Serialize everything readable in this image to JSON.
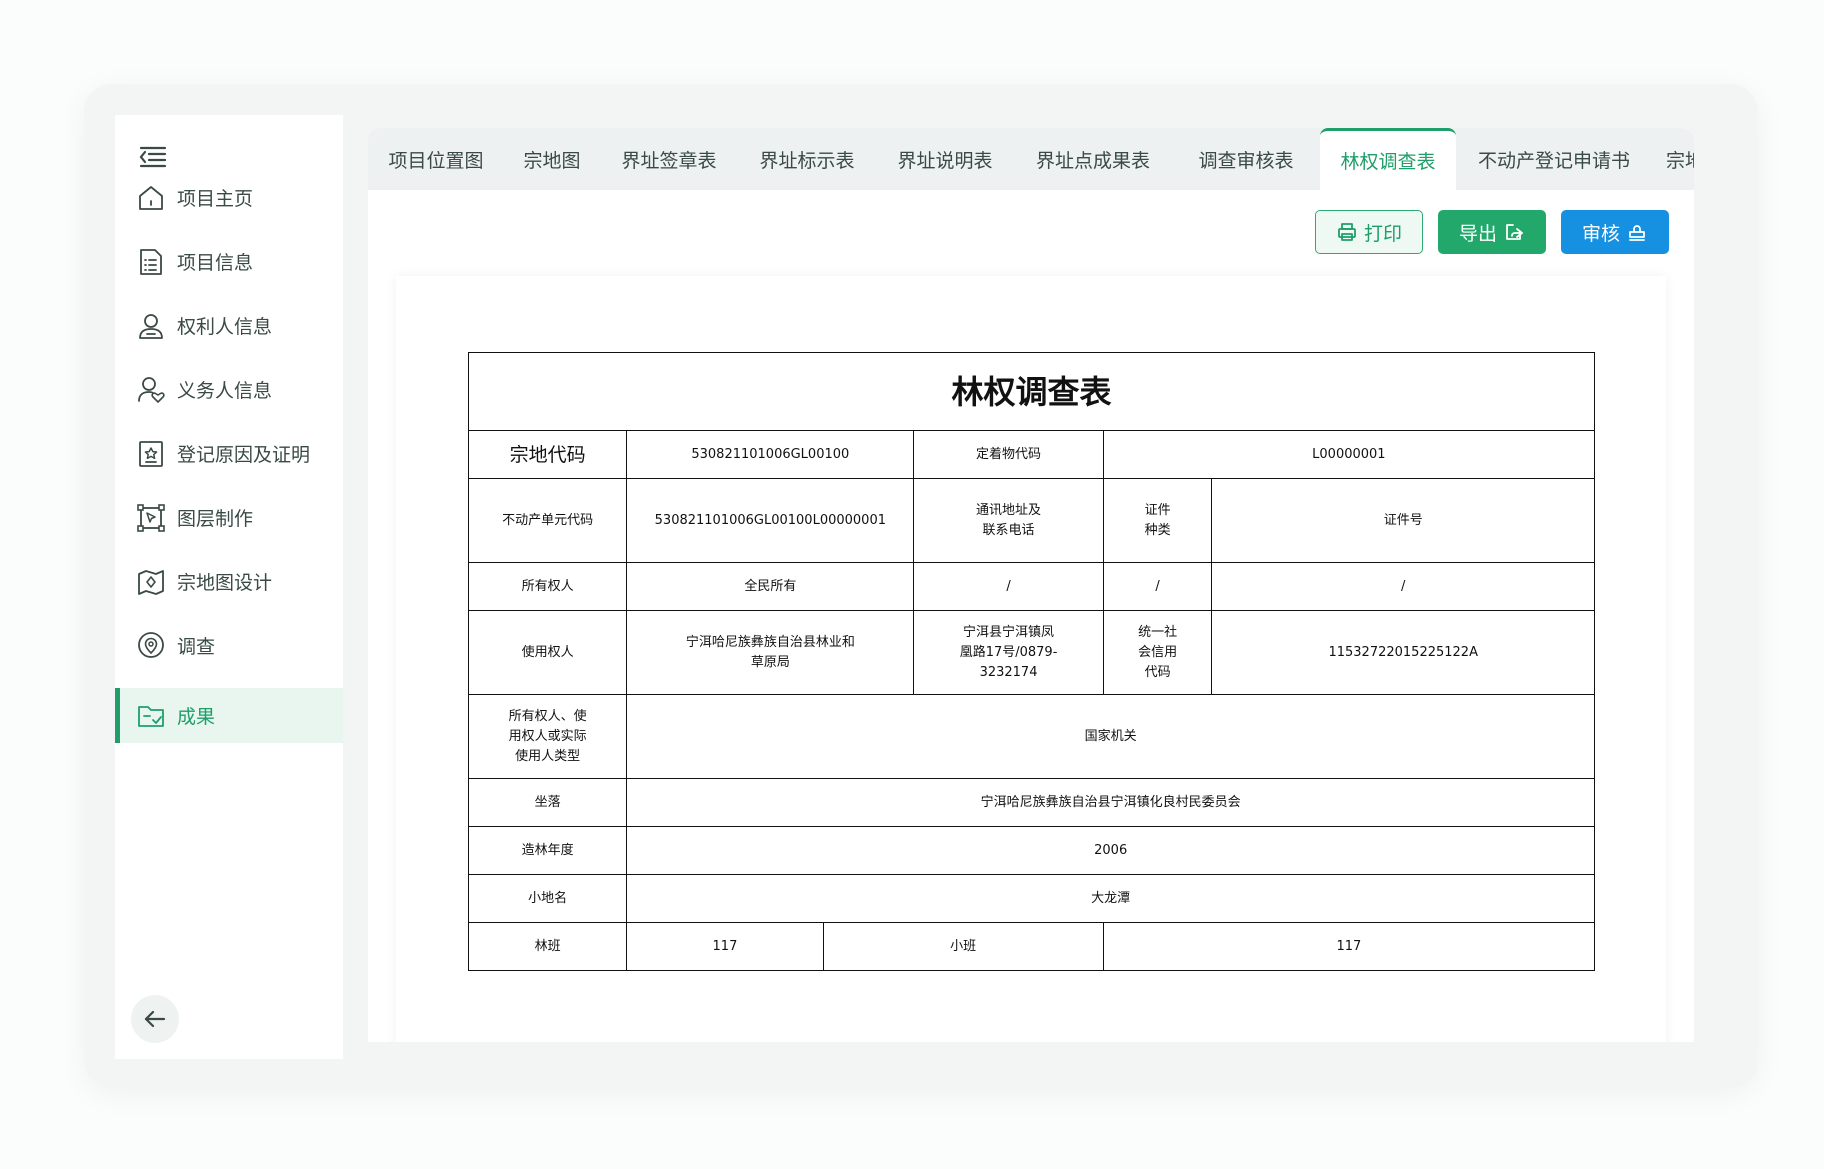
{
  "sidebar": {
    "items": [
      {
        "label": "项目主页",
        "icon": "home-icon"
      },
      {
        "label": "项目信息",
        "icon": "document-list-icon"
      },
      {
        "label": "权利人信息",
        "icon": "user-icon"
      },
      {
        "label": "义务人信息",
        "icon": "user-heart-icon"
      },
      {
        "label": "登记原因及证明",
        "icon": "certificate-icon"
      },
      {
        "label": "图层制作",
        "icon": "layer-select-icon"
      },
      {
        "label": "宗地图设计",
        "icon": "map-design-icon"
      },
      {
        "label": "调查",
        "icon": "location-pin-icon"
      },
      {
        "label": "成果",
        "icon": "folder-check-icon"
      }
    ],
    "active": "成果"
  },
  "tabs": [
    "项目位置图",
    "宗地图",
    "界址签章表",
    "界址标示表",
    "界址说明表",
    "界址点成果表",
    "调查审核表",
    "林权调查表",
    "不动产登记申请书",
    "宗地"
  ],
  "active_tab": "林权调查表",
  "toolbar": {
    "print_label": "打印",
    "export_label": "导出",
    "audit_label": "审核"
  },
  "form": {
    "title": "林权调查表",
    "parcel_code_label": "宗地代码",
    "parcel_code": "530821101006GL00100",
    "fixture_code_label": "定着物代码",
    "fixture_code": "L00000001",
    "unit_code_label": "不动产单元代码",
    "unit_code": "530821101006GL00100L00000001",
    "contact_label": "通讯地址及联系电话",
    "cert_type_label": "证件种类",
    "cert_no_label": "证件号",
    "owner_label": "所有权人",
    "owner": "全民所有",
    "owner_contact": "/",
    "owner_cert_type": "/",
    "owner_cert_no": "/",
    "user_label": "使用权人",
    "user": "宁洱哈尼族彝族自治县林业和草原局",
    "user_contact": "宁洱县宁洱镇凤凰路17号/0879-3232174",
    "user_cert_type": "统一社会信用代码",
    "user_cert_no": "11532722015225122A",
    "type_label": "所有权人、使用权人或实际使用人类型",
    "type_value": "国家机关",
    "location_label": "坐落",
    "location": "宁洱哈尼族彝族自治县宁洱镇化良村民委员会",
    "year_label": "造林年度",
    "year": "2006",
    "place_label": "小地名",
    "place": "大龙潭",
    "forest_class_label": "林班",
    "forest_class": "117",
    "sub_class_label": "小班",
    "sub_class": "117"
  }
}
